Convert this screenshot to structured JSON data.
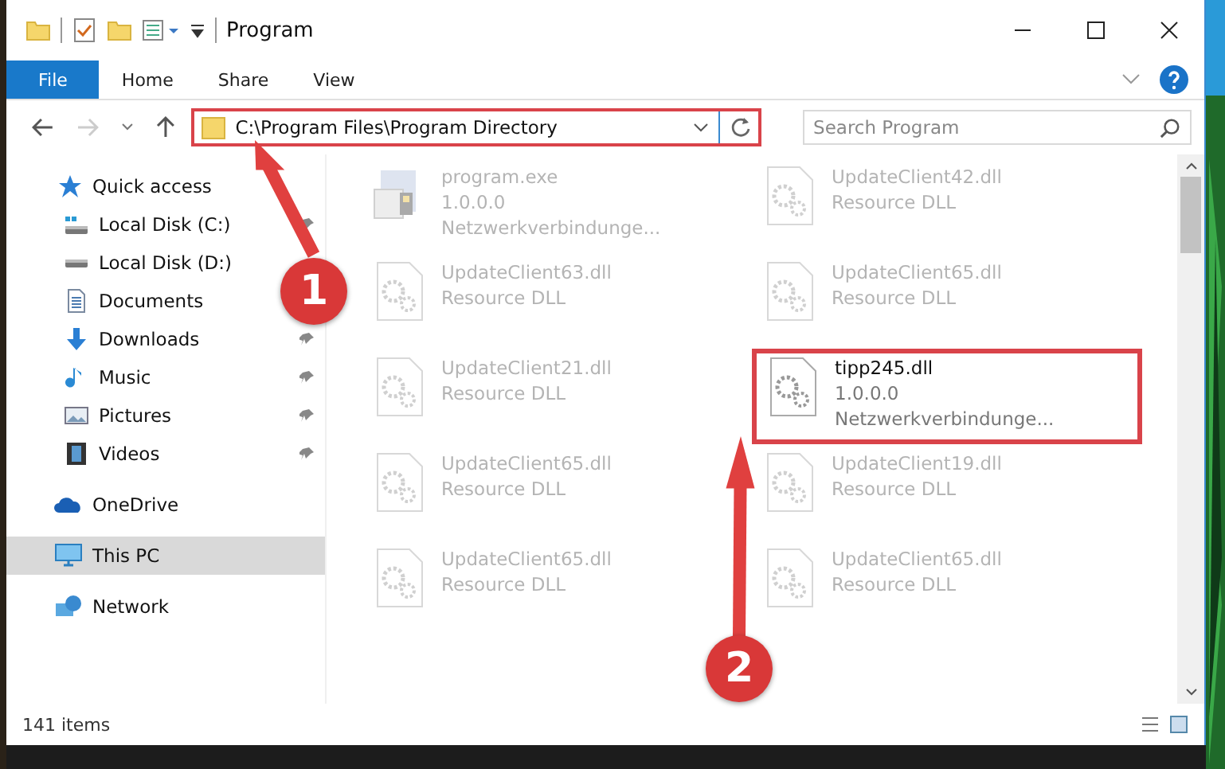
{
  "window": {
    "title": "Program"
  },
  "ribbon_tabs": [
    {
      "label": "File",
      "selected": true
    },
    {
      "label": "Home",
      "selected": false
    },
    {
      "label": "Share",
      "selected": false
    },
    {
      "label": "View",
      "selected": false
    }
  ],
  "address_bar": {
    "value": "C:\\Program Files\\Program Directory",
    "highlighted": true
  },
  "search": {
    "placeholder": "Search Program"
  },
  "sidebar": {
    "items": [
      {
        "label": "Quick access",
        "kind": "star",
        "selected": false,
        "children": [
          {
            "label": "Local Disk (C:)",
            "kind": "drive-c",
            "pinned": true,
            "selected": false
          },
          {
            "label": "Local Disk (D:)",
            "kind": "drive",
            "selected": false
          },
          {
            "label": "Documents",
            "kind": "document",
            "selected": false
          },
          {
            "label": "Downloads",
            "kind": "download",
            "pinned": true,
            "selected": false
          },
          {
            "label": "Music",
            "kind": "music",
            "pinned": true,
            "selected": false
          },
          {
            "label": "Pictures",
            "kind": "pictures",
            "pinned": true,
            "selected": false
          },
          {
            "label": "Videos",
            "kind": "video",
            "pinned": true,
            "selected": false
          }
        ]
      },
      {
        "label": "OneDrive",
        "kind": "cloud",
        "selected": false
      },
      {
        "label": "This PC",
        "kind": "pc",
        "selected": true
      },
      {
        "label": "Network",
        "kind": "network",
        "selected": false
      }
    ]
  },
  "files": [
    {
      "kind": "exe",
      "name": "program.exe",
      "lines": [
        "1.0.0.0",
        "Netzwerkverbindunge..."
      ],
      "dimmed": true,
      "highlighted": false
    },
    {
      "kind": "dll",
      "name": "UpdateClient42.dll",
      "lines": [
        "Resource DLL"
      ],
      "dimmed": true,
      "highlighted": false
    },
    {
      "kind": "dll",
      "name": "UpdateClient63.dll",
      "lines": [
        "Resource DLL"
      ],
      "dimmed": true,
      "highlighted": false
    },
    {
      "kind": "dll",
      "name": "UpdateClient65.dll",
      "lines": [
        "Resource DLL"
      ],
      "dimmed": true,
      "highlighted": false
    },
    {
      "kind": "dll",
      "name": "UpdateClient21.dll",
      "lines": [
        "Resource DLL"
      ],
      "dimmed": true,
      "highlighted": false
    },
    {
      "kind": "dll",
      "name": "tipp245.dll",
      "lines": [
        "1.0.0.0",
        "Netzwerkverbindunge..."
      ],
      "dimmed": false,
      "highlighted": true
    },
    {
      "kind": "dll",
      "name": "UpdateClient65.dll",
      "lines": [
        "Resource DLL"
      ],
      "dimmed": true,
      "highlighted": false
    },
    {
      "kind": "dll",
      "name": "UpdateClient19.dll",
      "lines": [
        "Resource DLL"
      ],
      "dimmed": true,
      "highlighted": false
    },
    {
      "kind": "dll",
      "name": "UpdateClient65.dll",
      "lines": [
        "Resource DLL"
      ],
      "dimmed": true,
      "highlighted": false
    },
    {
      "kind": "dll",
      "name": "UpdateClient65.dll",
      "lines": [
        "Resource DLL"
      ],
      "dimmed": true,
      "highlighted": false
    }
  ],
  "status_bar": {
    "count": "141 items"
  },
  "callouts": [
    {
      "number": "1"
    },
    {
      "number": "2"
    }
  ]
}
